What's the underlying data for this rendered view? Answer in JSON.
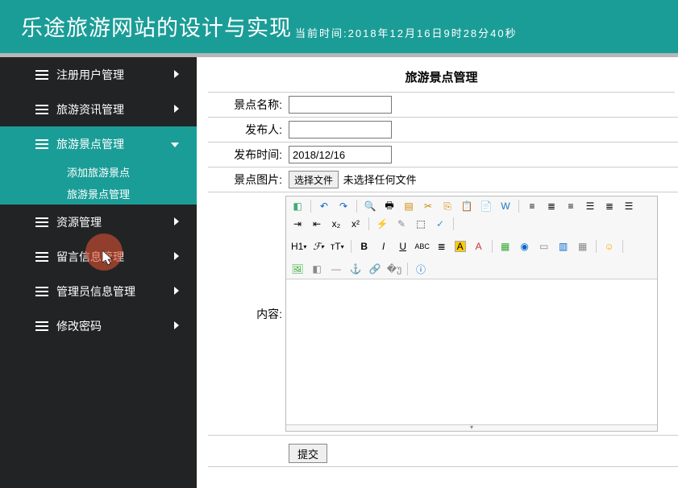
{
  "header": {
    "title": "乐途旅游网站的设计与实现",
    "time_prefix": "当前时间:",
    "time_value": "2018年12月16日9时28分40秒"
  },
  "sidebar": {
    "items": [
      {
        "label": "注册用户管理",
        "expanded": false
      },
      {
        "label": "旅游资讯管理",
        "expanded": false
      },
      {
        "label": "旅游景点管理",
        "expanded": true,
        "children": [
          {
            "label": "添加旅游景点"
          },
          {
            "label": "旅游景点管理"
          }
        ]
      },
      {
        "label": "资源管理",
        "expanded": false
      },
      {
        "label": "留言信息管理",
        "expanded": false
      },
      {
        "label": "管理员信息管理",
        "expanded": false
      },
      {
        "label": "修改密码",
        "expanded": false
      }
    ]
  },
  "panel": {
    "title": "旅游景点管理",
    "fields": {
      "name_label": "景点名称:",
      "publisher_label": "发布人:",
      "pubtime_label": "发布时间:",
      "pubtime_value": "2018/12/16",
      "image_label": "景点图片:",
      "file_btn": "选择文件",
      "file_status": "未选择任何文件",
      "content_label": "内容:"
    },
    "submit": "提交"
  },
  "editor": {
    "row1": [
      "source",
      "|",
      "undo",
      "redo",
      "|",
      "preview",
      "print",
      "template",
      "cut",
      "copy",
      "paste",
      "paste-text",
      "paste-word",
      "|",
      "align-left",
      "align-center",
      "align-right",
      "align-justify",
      "list-ol",
      "list-ul",
      "indent",
      "outdent"
    ],
    "row2_prefix": [
      "subscript",
      "superscript",
      "|",
      "remove-format",
      "quick-format",
      "select-all",
      "clear",
      "|"
    ],
    "row3_text": [
      {
        "t": "H1",
        "sfx": "▾"
      },
      {
        "t": "F",
        "sfx": "▾"
      },
      {
        "t": "ᴛT",
        "sfx": "▾"
      }
    ],
    "row3_icons": [
      "|",
      "bold",
      "italic",
      "underline",
      "strike",
      "line-height",
      "fgcolor",
      "bgcolor",
      "|",
      "picture",
      "flash",
      "video",
      "music",
      "map",
      "link",
      "unlink",
      "|",
      "emoji",
      "|"
    ],
    "row4": [
      "image",
      "landscape",
      "hr",
      "anchor",
      "link2",
      "unlink2",
      "|",
      "about"
    ]
  }
}
